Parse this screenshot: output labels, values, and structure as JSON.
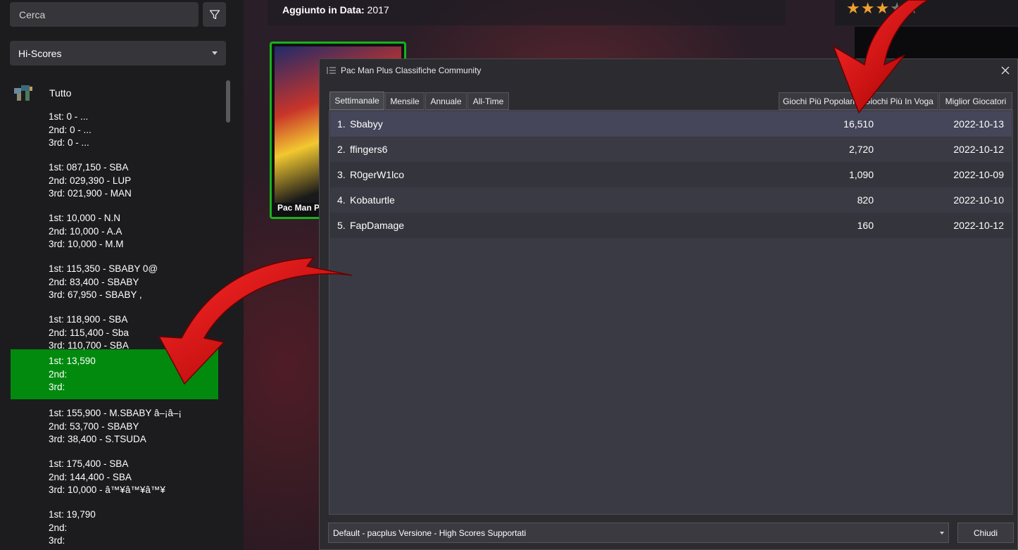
{
  "sidebar": {
    "search_placeholder": "Cerca",
    "filter_icon": "filter-icon",
    "category_selected": "Hi-Scores",
    "all_label": "Tutto",
    "scores": [
      {
        "l1": "1st: 0 - ...",
        "l2": "2nd: 0 - ...",
        "l3": "3rd: 0 - ..."
      },
      {
        "l1": "1st: 087,150 - SBA",
        "l2": "2nd: 029,390 - LUP",
        "l3": "3rd: 021,900 - MAN"
      },
      {
        "l1": "1st: 10,000 - N.N",
        "l2": "2nd: 10,000 - A.A",
        "l3": "3rd: 10,000 - M.M"
      },
      {
        "l1": "1st: 115,350 - SBABY 0@",
        "l2": "2nd: 83,400 - SBABY",
        "l3": "3rd: 67,950 - SBABY  ,"
      },
      {
        "l1": "1st: 118,900 - SBA",
        "l2": "2nd: 115,400 - Sba",
        "l3": "3rd: 110,700 - SBA"
      },
      {
        "l1": "1st: 13,590",
        "l2": "2nd:",
        "l3": "3rd:"
      },
      {
        "l1": "1st: 155,900 - M.SBABY â–¡â–¡",
        "l2": "2nd: 53,700 - SBABY",
        "l3": "3rd: 38,400 - S.TSUDA"
      },
      {
        "l1": "1st: 175,400 - SBA",
        "l2": "2nd: 144,400 - SBA",
        "l3": "3rd: 10,000 - â™¥â™¥â™¥"
      },
      {
        "l1": "1st: 19,790",
        "l2": "2nd:",
        "l3": "3rd:"
      }
    ],
    "selected_index": 5
  },
  "main": {
    "added_label": "Aggiunto in Data:",
    "added_value": "2017",
    "rating_stars": 3,
    "rating_max": 5,
    "game_tile_title": "Pac Man Pl"
  },
  "dialog": {
    "title": "Pac Man Plus Classifiche Community",
    "tabs_left": [
      "Settimanale",
      "Mensile",
      "Annuale",
      "All-Time"
    ],
    "tabs_right": [
      "Giochi Più Popolari",
      "Giochi Più In Voga",
      "Miglior Giocatori"
    ],
    "active_tab": "Settimanale",
    "rows": [
      {
        "pos": "1.",
        "name": "Sbabyy",
        "score": "16,510",
        "date": "2022-10-13"
      },
      {
        "pos": "2.",
        "name": "ffingers6",
        "score": "2,720",
        "date": "2022-10-12"
      },
      {
        "pos": "3.",
        "name": "R0gerW1lco",
        "score": "1,090",
        "date": "2022-10-09"
      },
      {
        "pos": "4.",
        "name": "Kobaturtle",
        "score": "820",
        "date": "2022-10-10"
      },
      {
        "pos": "5.",
        "name": "FapDamage",
        "score": "160",
        "date": "2022-10-12"
      }
    ],
    "footer_select": "Default - pacplus Versione - High Scores Supportati",
    "close_button": "Chiudi"
  },
  "colors": {
    "selected_green": "#028a0f",
    "tile_border": "#17b21a",
    "arrow_red": "#d01010",
    "star": "#f0a030"
  }
}
